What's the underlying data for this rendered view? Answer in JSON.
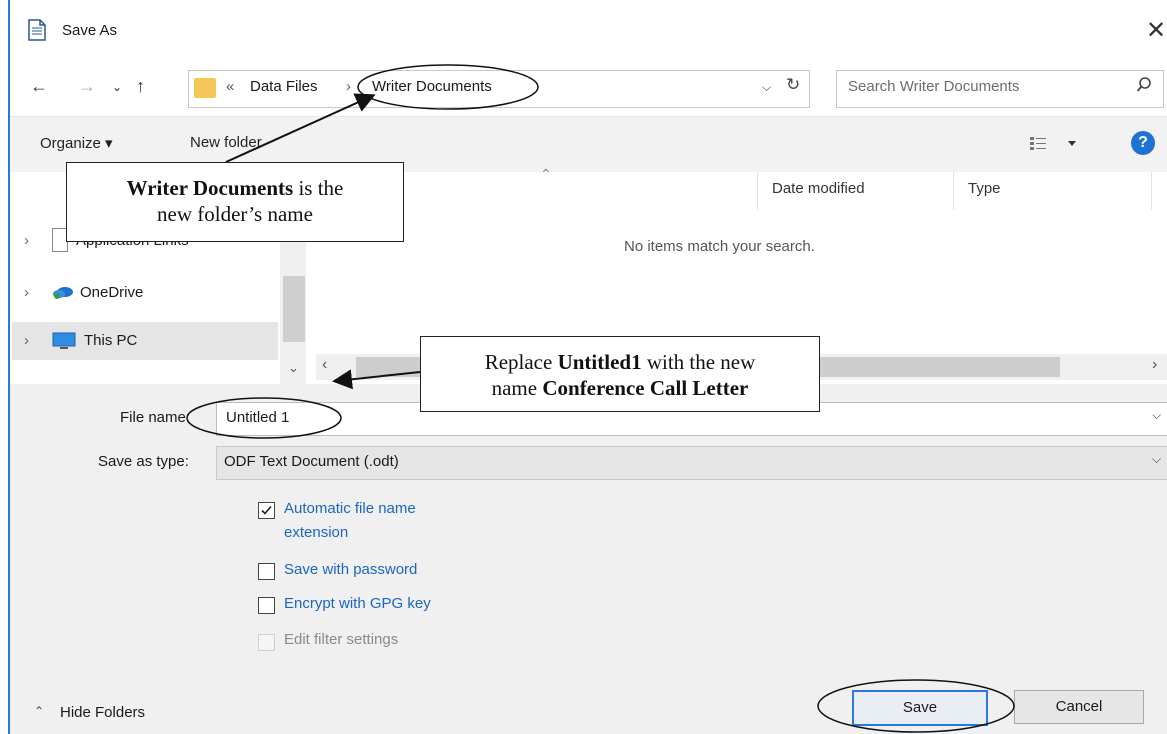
{
  "window": {
    "title": "Save As"
  },
  "address": {
    "chevron": "«",
    "path": [
      "Data Files",
      "Writer Documents"
    ],
    "separator": "›"
  },
  "search": {
    "placeholder": "Search Writer Documents"
  },
  "toolbar": {
    "organize": "Organize ▾",
    "new_folder": "New folder"
  },
  "nav": {
    "items": [
      {
        "label": "Application Links"
      },
      {
        "label": "OneDrive"
      },
      {
        "label": "This PC"
      }
    ]
  },
  "files": {
    "columns": [
      "Date modified",
      "Type"
    ],
    "empty_message": "No items match your search."
  },
  "form": {
    "file_name_label": "File name:",
    "file_name_value": "Untitled 1",
    "save_type_label": "Save as type:",
    "save_type_value": "ODF Text Document (.odt)",
    "options": [
      {
        "label_line1": "Automatic file name",
        "label_line2": "extension",
        "checked": true,
        "enabled": true
      },
      {
        "label_line1": "Save with password",
        "checked": false,
        "enabled": true
      },
      {
        "label_line1": "Encrypt with GPG key",
        "checked": false,
        "enabled": true
      },
      {
        "label_line1": "Edit filter settings",
        "checked": false,
        "enabled": false
      }
    ]
  },
  "footer": {
    "hide_folders": "Hide Folders",
    "save": "Save",
    "cancel": "Cancel"
  },
  "callouts": {
    "folder_bold": "Writer Documents",
    "folder_rest1": " is the",
    "folder_line2": "new folder’s name",
    "rename_pre": "Replace ",
    "rename_bold": "Untitled1",
    "rename_post": " with the new",
    "rename_line2_pre": "name ",
    "rename_line2_bold": "Conference Call Letter"
  },
  "colors": {
    "accent": "#2b79d6",
    "link": "#1a66c2",
    "help": "#1e73d2"
  }
}
